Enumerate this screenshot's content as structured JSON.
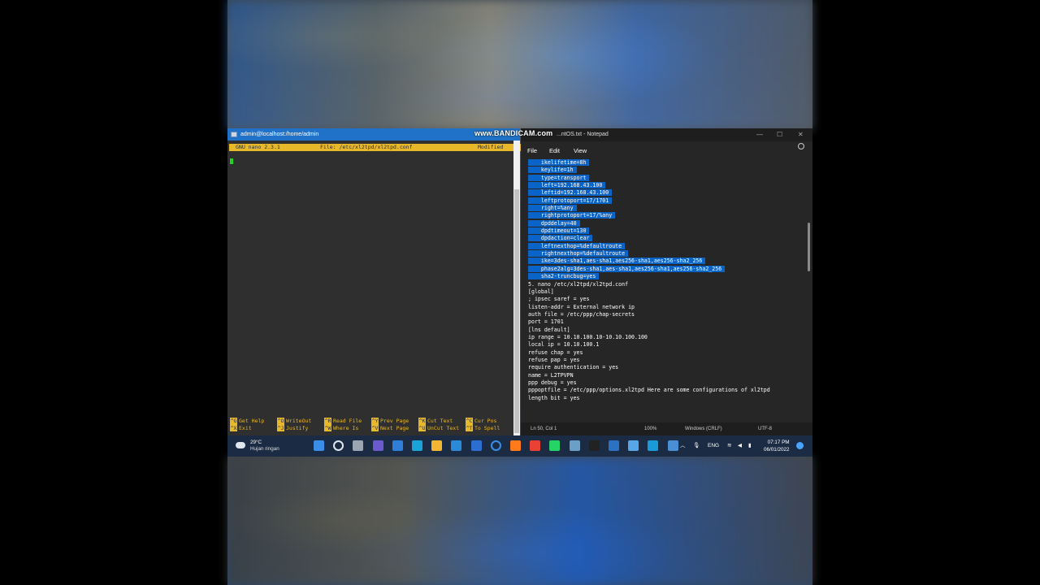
{
  "watermark": "www.BANDICAM.com",
  "putty": {
    "title": "admin@localhost:/home/admin",
    "nano_version": "GNU nano 2.3.1",
    "file_label": "File: /etc/xl2tpd/xl2tpd.conf",
    "status": "Modified",
    "shortcuts": [
      {
        "k1": "^G",
        "l1": "Get Help",
        "k2": "^X",
        "l2": "Exit"
      },
      {
        "k1": "^O",
        "l1": "WriteOut",
        "k2": "^J",
        "l2": "Justify"
      },
      {
        "k1": "^R",
        "l1": "Read File",
        "k2": "^W",
        "l2": "Where Is"
      },
      {
        "k1": "^Y",
        "l1": "Prev Page",
        "k2": "^V",
        "l2": "Next Page"
      },
      {
        "k1": "^K",
        "l1": "Cut Text",
        "k2": "^U",
        "l2": "UnCut Text"
      },
      {
        "k1": "^C",
        "l1": "Cur Pos",
        "k2": "^T",
        "l2": "To Spell"
      }
    ]
  },
  "notepad": {
    "title": "...ntOS.txt - Notepad",
    "menu": {
      "file": "File",
      "edit": "Edit",
      "view": "View"
    },
    "lines_selected": [
      "    ikelifetime=8h",
      "    keylife=1h",
      "    type=transport",
      "    left=192.168.43.100",
      "    leftid=192.168.43.100",
      "    leftprotoport=17/1701",
      "    right=%any",
      "    rightprotoport=17/%any",
      "    dpddelay=40",
      "    dpdtimeout=130",
      "    dpdaction=clear",
      "    leftnexthop=%defaultroute",
      "    rightnexthop=%defaultroute",
      "    ike=3des-sha1,aes-sha1,aes256-sha1,aes256-sha2_256",
      "    phase2alg=3des-sha1,aes-sha1,aes256-sha1,aes256-sha2_256",
      "    sha2-truncbug=yes"
    ],
    "lines_plain": [
      "5. nano /etc/xl2tpd/xl2tpd.conf",
      "[global]",
      "; ipsec saref = yes",
      "listen-addr = External network ip",
      "auth file = /etc/ppp/chap-secrets",
      "port = 1701",
      "[lns default]",
      "ip range = 10.10.100.10-10.10.100.100",
      "local ip = 10.10.100.1",
      "refuse chap = yes",
      "refuse pap = yes",
      "require authentication = yes",
      "name = L2TPVPN",
      "ppp debug = yes",
      "pppoptfile = /etc/ppp/options.xl2tpd Here are some configurations of xl2tpd",
      "length bit = yes"
    ],
    "status": {
      "position": "Ln 50, Col 1",
      "zoom": "100%",
      "line_ending": "Windows (CRLF)",
      "encoding": "UTF-8"
    }
  },
  "taskbar": {
    "weather_temp": "29°C",
    "weather_desc": "Hujan ringan",
    "language": "ENG",
    "time": "07:17 PM",
    "date": "06/01/2022",
    "icons": [
      "start-icon",
      "search-icon",
      "task-view-icon",
      "teams-chat-icon",
      "widgets-icon",
      "edge-icon",
      "file-explorer-icon",
      "mail-icon",
      "lync-icon",
      "cortana-icon",
      "firefox-icon",
      "chrome-icon",
      "whatsapp-icon",
      "photos-icon",
      "terminal-icon",
      "outlook-icon",
      "notepad-icon",
      "monitor-icon",
      "putty-icon"
    ]
  }
}
